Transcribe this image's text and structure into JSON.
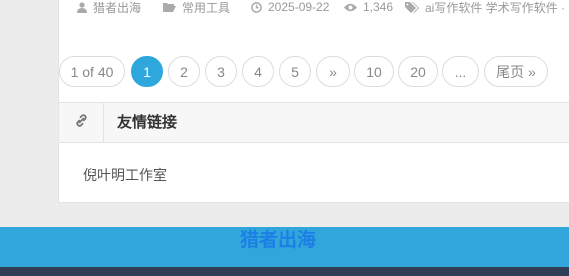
{
  "post_meta": {
    "author": "猎者出海",
    "category": "常用工具",
    "date": "2025-09-22",
    "views": "1,346",
    "tags": "ai写作软件  学术写作软件  ·"
  },
  "pagination": {
    "summary": "1 of 40",
    "pages": [
      "1",
      "2",
      "3",
      "4",
      "5"
    ],
    "next": "»",
    "jump1": "10",
    "jump2": "20",
    "ellipsis": "...",
    "last": "尾页 »",
    "current": "1"
  },
  "friend_links": {
    "title": "友情链接",
    "items": [
      "倪叶明工作室"
    ]
  },
  "footer": {
    "brand": "猎者出海"
  },
  "colors": {
    "accent": "#2ea7dd",
    "footer_blue": "#31a6db",
    "footer_dark": "#2f3e55"
  }
}
